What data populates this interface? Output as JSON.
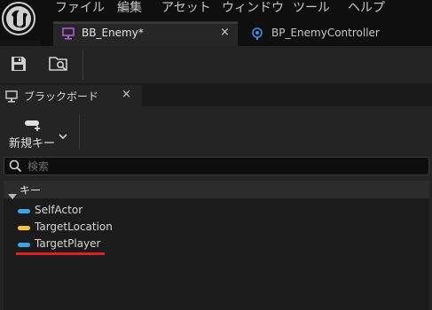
{
  "menu": [
    "ファイル",
    "編集",
    "アセット",
    "ウィンドウ",
    "ツール",
    "ヘルプ"
  ],
  "tabs": [
    {
      "label": "BB_Enemy*",
      "close": "×",
      "active": true
    },
    {
      "label": "BP_EnemyController",
      "active": false
    }
  ],
  "toolbar": {
    "save_icon": "save-icon",
    "browse_icon": "browse-asset-icon"
  },
  "panel": {
    "title": "ブラックボード",
    "close": "×",
    "new_key_label": "新規キー",
    "search_placeholder": "検索",
    "category": "キー",
    "keys": [
      {
        "name": "SelfActor",
        "color": "#3aa6e8"
      },
      {
        "name": "TargetLocation",
        "color": "#f5c542"
      },
      {
        "name": "TargetPlayer",
        "color": "#3aa6e8"
      }
    ]
  },
  "colors": {
    "highlight_underline": "#e02020",
    "object_key": "#3aa6e8",
    "vector_key": "#f5c542"
  }
}
